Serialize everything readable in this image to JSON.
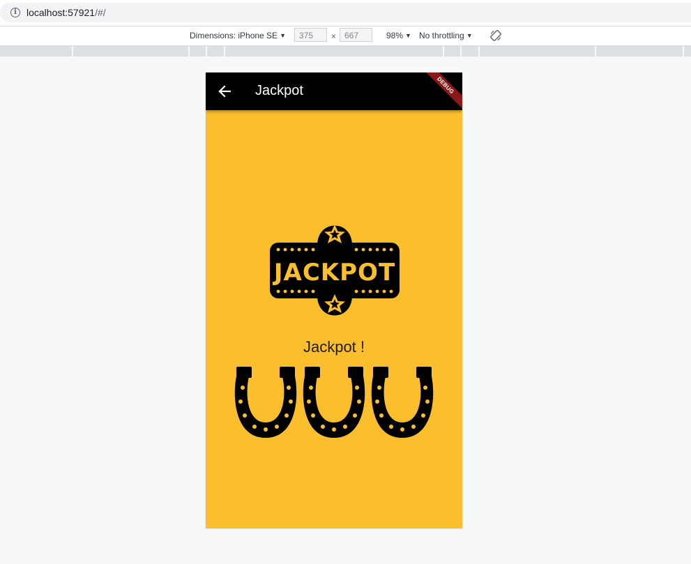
{
  "browser": {
    "url_host": "localhost:57921",
    "url_path": "/#/",
    "info_icon": "info-icon"
  },
  "device_toolbar": {
    "dimensions_label": "Dimensions: iPhone SE",
    "width": "375",
    "height": "667",
    "times": "×",
    "zoom": "98%",
    "throttling": "No throttling",
    "rotate_icon": "rotate-icon"
  },
  "app": {
    "title": "Jackpot",
    "debug_banner": "DEBUG",
    "logo_text": "JACKPOT",
    "message": "Jackpot !",
    "horseshoe_count": 3,
    "colors": {
      "background": "#fbbf2d",
      "appbar": "#000000",
      "debug_banner": "#8a1a1a"
    }
  }
}
